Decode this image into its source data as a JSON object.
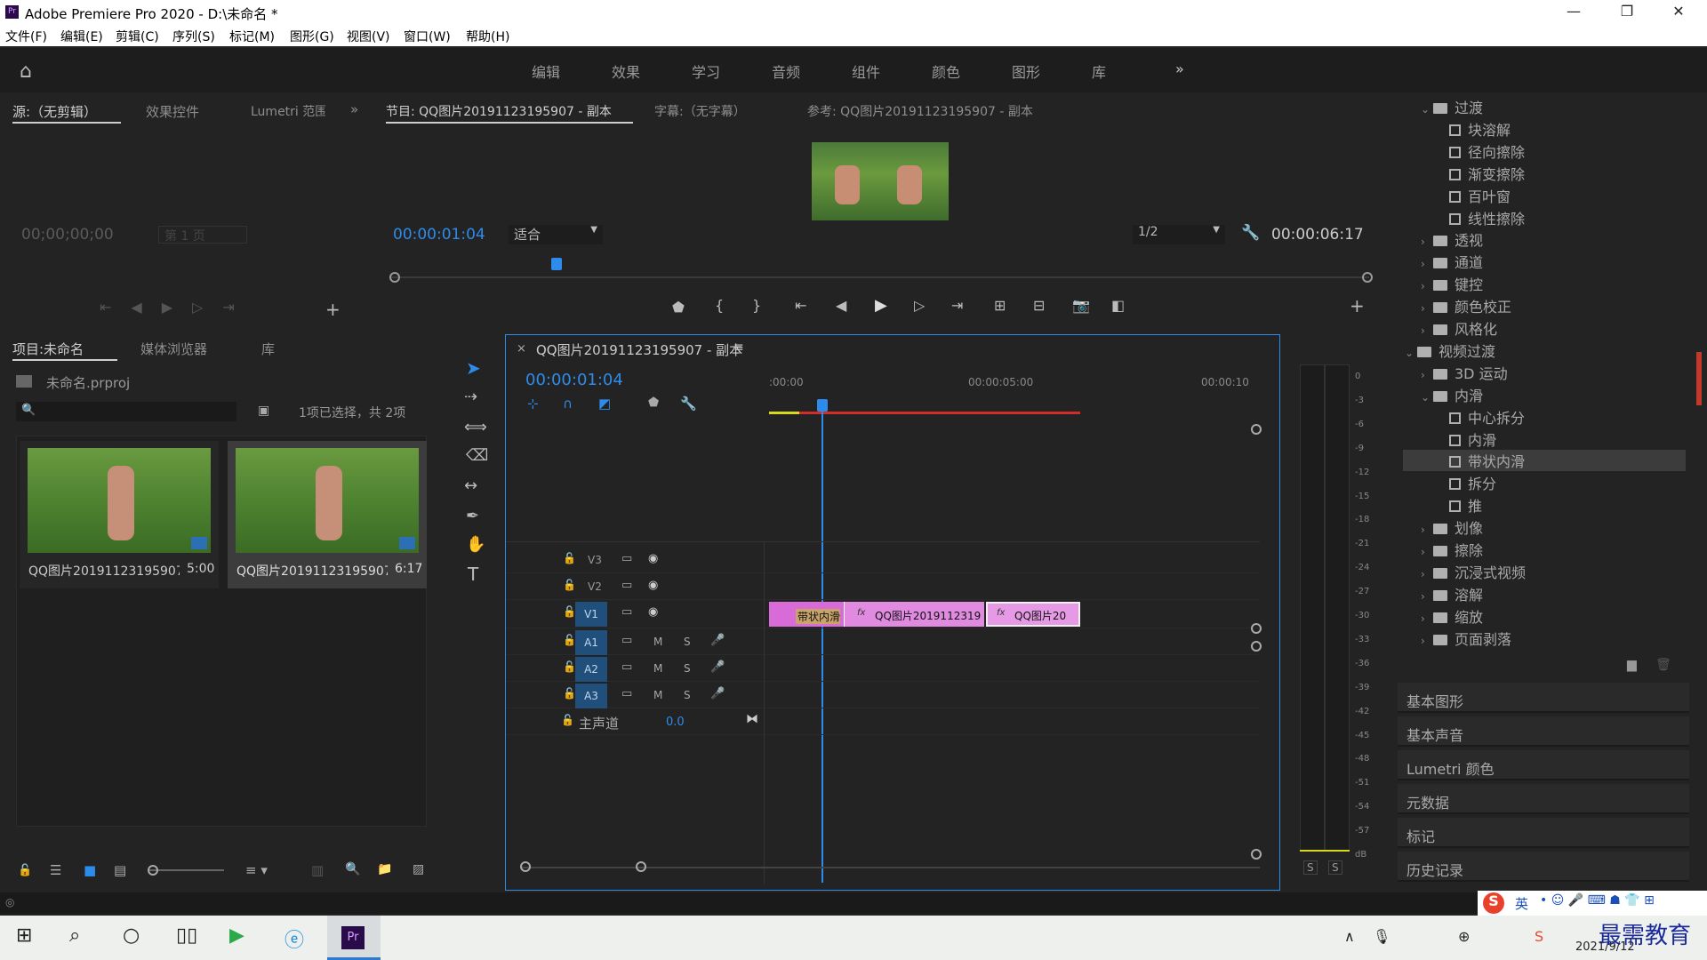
{
  "window": {
    "title": "Adobe Premiere Pro 2020 - D:\\未命名 *",
    "app_icon": "Pr"
  },
  "menu": [
    "文件(F)",
    "编辑(E)",
    "剪辑(C)",
    "序列(S)",
    "标记(M)",
    "图形(G)",
    "视图(V)",
    "窗口(W)",
    "帮助(H)"
  ],
  "workspaces": [
    "编辑",
    "效果",
    "学习",
    "音频",
    "组件",
    "颜色",
    "图形",
    "库"
  ],
  "source": {
    "tabs": [
      "源:（无剪辑）",
      "效果控件",
      "Lumetri 范围"
    ],
    "timecode": "00;00;00;00",
    "page": "第 1 页"
  },
  "program": {
    "tabs": [
      "节目: QQ图片20191123195907 - 副本",
      "字幕:（无字幕）",
      "参考: QQ图片20191123195907 - 副本"
    ],
    "timecode": "00:00:01:04",
    "fit": "适合",
    "quality": "1/2",
    "duration": "00:00:06:17"
  },
  "project": {
    "tabs": [
      "项目:未命名",
      "媒体浏览器",
      "库"
    ],
    "file": "未命名.prproj",
    "selection": "1项已选择，共 2项",
    "items": [
      {
        "name": "QQ图片20191123195907...",
        "dur": "5:00"
      },
      {
        "name": "QQ图片20191123195907...",
        "dur": "6:17"
      }
    ]
  },
  "timeline": {
    "title": "QQ图片20191123195907 - 副本",
    "timecode": "00:00:01:04",
    "ruler": [
      ":00:00",
      "00:00:05:00",
      "00:00:10"
    ],
    "video_tracks": [
      "V3",
      "V2",
      "V1"
    ],
    "audio_tracks": [
      "A1",
      "A2",
      "A3"
    ],
    "master_label": "主声道",
    "master_value": "0.0",
    "clips": [
      {
        "label": "带状内滑"
      },
      {
        "label": "QQ图片20191123195"
      },
      {
        "label": "QQ图片20"
      }
    ]
  },
  "meter": {
    "scale": [
      "0",
      "-3",
      "-6",
      "-9",
      "-12",
      "-15",
      "-18",
      "-21",
      "-24",
      "-27",
      "-30",
      "-33",
      "-36",
      "-39",
      "-42",
      "-45",
      "-48",
      "-51",
      "-54",
      "-57",
      "dB"
    ],
    "solo": [
      "S",
      "S"
    ]
  },
  "effects": {
    "tree": [
      {
        "name": "过渡",
        "type": "folder",
        "open": true,
        "level": 1
      },
      {
        "name": "块溶解",
        "type": "effect",
        "level": 2
      },
      {
        "name": "径向擦除",
        "type": "effect",
        "level": 2
      },
      {
        "name": "渐变擦除",
        "type": "effect",
        "level": 2
      },
      {
        "name": "百叶窗",
        "type": "effect",
        "level": 2
      },
      {
        "name": "线性擦除",
        "type": "effect",
        "level": 2
      },
      {
        "name": "透视",
        "type": "folder",
        "level": 1
      },
      {
        "name": "通道",
        "type": "folder",
        "level": 1
      },
      {
        "name": "键控",
        "type": "folder",
        "level": 1
      },
      {
        "name": "颜色校正",
        "type": "folder",
        "level": 1
      },
      {
        "name": "风格化",
        "type": "folder",
        "level": 1
      },
      {
        "name": "视频过渡",
        "type": "folder",
        "open": true,
        "level": 0
      },
      {
        "name": "3D 运动",
        "type": "folder",
        "level": 1
      },
      {
        "name": "内滑",
        "type": "folder",
        "open": true,
        "level": 1
      },
      {
        "name": "中心拆分",
        "type": "effect",
        "level": 2
      },
      {
        "name": "内滑",
        "type": "effect",
        "level": 2
      },
      {
        "name": "带状内滑",
        "type": "effect",
        "level": 2,
        "selected": true
      },
      {
        "name": "拆分",
        "type": "effect",
        "level": 2
      },
      {
        "name": "推",
        "type": "effect",
        "level": 2
      },
      {
        "name": "划像",
        "type": "folder",
        "level": 1
      },
      {
        "name": "擦除",
        "type": "folder",
        "level": 1
      },
      {
        "name": "沉浸式视频",
        "type": "folder",
        "level": 1
      },
      {
        "name": "溶解",
        "type": "folder",
        "level": 1
      },
      {
        "name": "缩放",
        "type": "folder",
        "level": 1
      },
      {
        "name": "页面剥落",
        "type": "folder",
        "level": 1
      }
    ]
  },
  "right_panels": [
    "基本图形",
    "基本声音",
    "Lumetri 颜色",
    "元数据",
    "标记",
    "历史记录"
  ],
  "taskbar": {
    "ime": "英",
    "date": "2021/9/12",
    "watermark": "最需教育"
  }
}
